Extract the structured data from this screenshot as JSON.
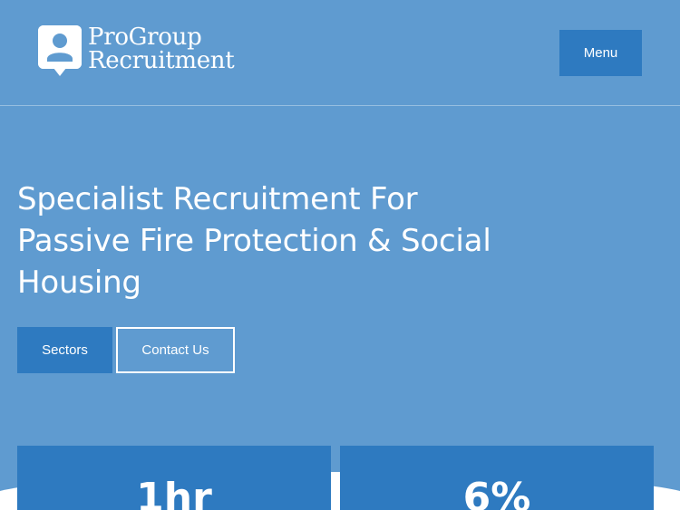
{
  "header": {
    "logo": {
      "line1": "ProGroup",
      "line2": "Recruitment",
      "icon": "user-badge-icon"
    },
    "menu_label": "Menu"
  },
  "hero": {
    "title_lines": [
      "Specialist Recruitment For",
      "Passive Fire Protection & Social",
      "Housing"
    ],
    "primary_button": "Sectors",
    "secondary_button": "Contact Us"
  },
  "stats": [
    {
      "value": "1hr"
    },
    {
      "value": "6%"
    }
  ],
  "colors": {
    "background": "#5f9bd0",
    "accent": "#2e7ac0",
    "text": "#ffffff"
  }
}
